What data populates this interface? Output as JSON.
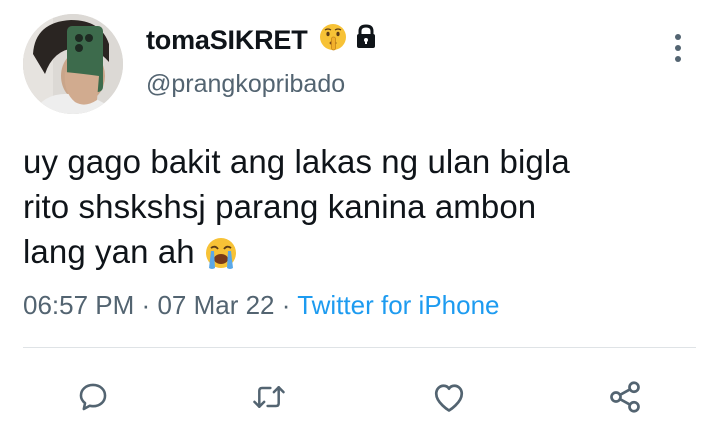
{
  "tweet": {
    "display_name": "tomaSIKRET",
    "name_emoji": "shushing-face-emoji",
    "protected_icon": "lock-icon",
    "handle": "@prangkopribado",
    "text_lines": [
      "uy gago bakit ang lakas ng ulan bigla",
      "rito shskshsj parang kanina ambon",
      "lang yan ah"
    ],
    "text_trailing_emoji": "loudly-crying-face-emoji",
    "time": "06:57 PM",
    "separator": "·",
    "date": "07 Mar 22",
    "source": "Twitter for iPhone"
  },
  "actions": [
    "reply-icon",
    "retweet-icon",
    "like-icon",
    "share-icon"
  ],
  "colors": {
    "text": "#0f1419",
    "secondary": "#536471",
    "link": "#1d9bf0",
    "divider": "#dfe3e6"
  }
}
